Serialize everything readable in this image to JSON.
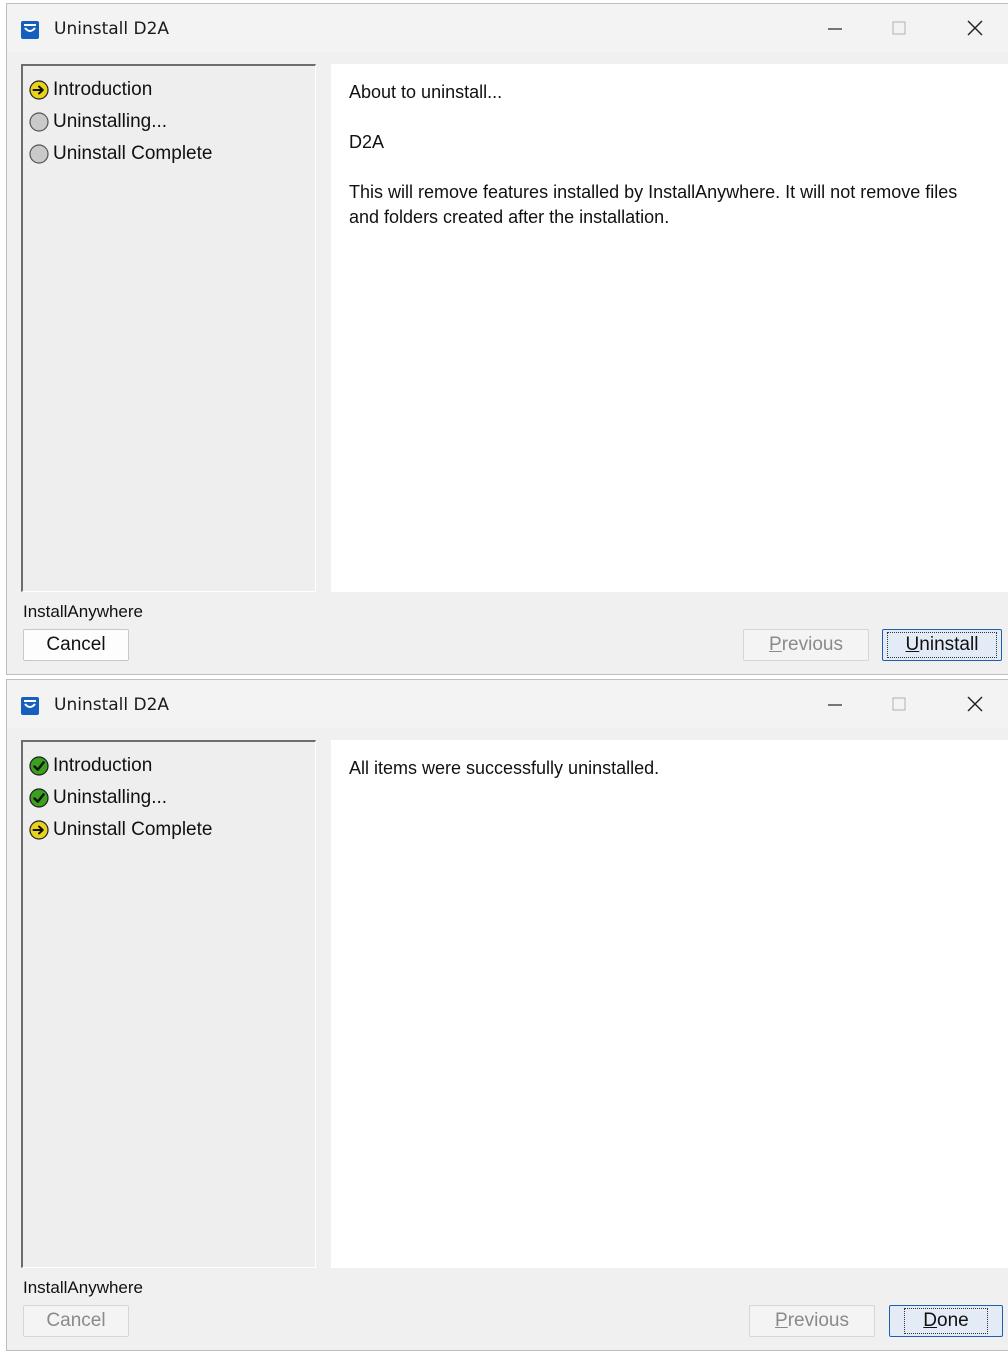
{
  "window1": {
    "title": "Uninstall D2A",
    "steps": [
      {
        "label": "Introduction",
        "status": "current"
      },
      {
        "label": "Uninstalling...",
        "status": "pending"
      },
      {
        "label": "Uninstall Complete",
        "status": "pending"
      }
    ],
    "content": {
      "line1": "About to uninstall...",
      "line2": "D2A",
      "line3": "This will remove features installed by InstallAnywhere.  It will not remove files and folders created after the installation."
    },
    "brand": "InstallAnywhere",
    "buttons": {
      "cancel": "Cancel",
      "previous_mnemonic": "P",
      "previous_rest": "revious",
      "primary_mnemonic": "U",
      "primary_rest": "ninstall"
    }
  },
  "window2": {
    "title": "Uninstall D2A",
    "steps": [
      {
        "label": "Introduction",
        "status": "done"
      },
      {
        "label": "Uninstalling...",
        "status": "done"
      },
      {
        "label": "Uninstall Complete",
        "status": "current"
      }
    ],
    "content": {
      "line1": "All items were successfully uninstalled."
    },
    "brand": "InstallAnywhere",
    "buttons": {
      "cancel": "Cancel",
      "previous_mnemonic": "P",
      "previous_rest": "revious",
      "primary_mnemonic": "D",
      "primary_rest": "one"
    }
  },
  "colors": {
    "step_current": "#e8d21a",
    "step_done": "#3aa020",
    "step_pending": "#c9c9c9",
    "app_icon": "#1560bd"
  },
  "icons": {
    "app": "installer-app-icon",
    "minimize": "minimize-icon",
    "maximize": "maximize-icon",
    "close": "close-icon",
    "current": "arrow-right-circle-icon",
    "done": "checkmark-circle-icon",
    "pending": "empty-circle-icon"
  }
}
